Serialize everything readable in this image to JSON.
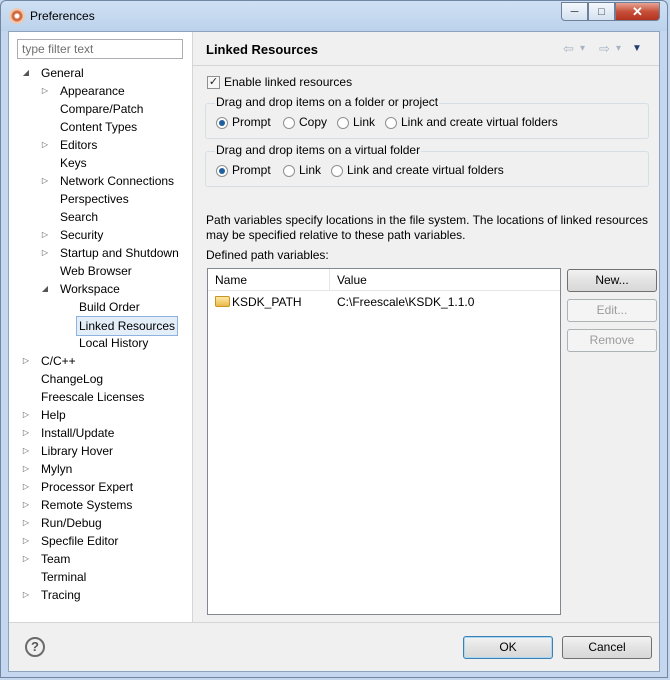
{
  "window": {
    "title": "Preferences"
  },
  "caption_buttons": {
    "minimize": "─",
    "maximize": "□",
    "close": "✕"
  },
  "filter": {
    "placeholder": "type filter text",
    "value": ""
  },
  "tree": [
    {
      "label": "General",
      "toggle": "◢"
    },
    {
      "label": "Appearance",
      "toggle": "▷"
    },
    {
      "label": "Compare/Patch",
      "toggle": ""
    },
    {
      "label": "Content Types",
      "toggle": ""
    },
    {
      "label": "Editors",
      "toggle": "▷"
    },
    {
      "label": "Keys",
      "toggle": ""
    },
    {
      "label": "Network Connections",
      "toggle": "▷"
    },
    {
      "label": "Perspectives",
      "toggle": ""
    },
    {
      "label": "Search",
      "toggle": ""
    },
    {
      "label": "Security",
      "toggle": "▷"
    },
    {
      "label": "Startup and Shutdown",
      "toggle": "▷"
    },
    {
      "label": "Web Browser",
      "toggle": ""
    },
    {
      "label": "Workspace",
      "toggle": "◢"
    },
    {
      "label": "Build Order",
      "toggle": ""
    },
    {
      "label": "Linked Resources",
      "toggle": ""
    },
    {
      "label": "Local History",
      "toggle": ""
    },
    {
      "label": "C/C++",
      "toggle": "▷"
    },
    {
      "label": "ChangeLog",
      "toggle": ""
    },
    {
      "label": "Freescale Licenses",
      "toggle": ""
    },
    {
      "label": "Help",
      "toggle": "▷"
    },
    {
      "label": "Install/Update",
      "toggle": "▷"
    },
    {
      "label": "Library Hover",
      "toggle": "▷"
    },
    {
      "label": "Mylyn",
      "toggle": "▷"
    },
    {
      "label": "Processor Expert",
      "toggle": "▷"
    },
    {
      "label": "Remote Systems",
      "toggle": "▷"
    },
    {
      "label": "Run/Debug",
      "toggle": "▷"
    },
    {
      "label": "Specfile Editor",
      "toggle": "▷"
    },
    {
      "label": "Team",
      "toggle": "▷"
    },
    {
      "label": "Terminal",
      "toggle": ""
    },
    {
      "label": "Tracing",
      "toggle": "▷"
    }
  ],
  "page": {
    "title": "Linked Resources",
    "nav": {
      "back": "⇦",
      "back_menu": "▾",
      "forward": "⇨",
      "forward_menu": "▾",
      "view_menu": "▼"
    },
    "enable_linked": {
      "label": "Enable linked resources",
      "checked": true,
      "mark": "✓"
    },
    "group1": {
      "title": "Drag and drop items on a folder or project",
      "options": [
        "Prompt",
        "Copy",
        "Link",
        "Link and create virtual folders"
      ],
      "selected": "Prompt"
    },
    "group2": {
      "title": "Drag and drop items on a virtual folder",
      "options": [
        "Prompt",
        "Link",
        "Link and create virtual folders"
      ],
      "selected": "Prompt"
    },
    "path_description": "Path variables specify locations in the file system. The locations of linked resources may be specified relative to these path variables.",
    "defined_label": "Defined path variables:",
    "table": {
      "columns": [
        "Name",
        "Value"
      ],
      "rows": [
        {
          "name": "KSDK_PATH",
          "value": "C:\\Freescale\\KSDK_1.1.0"
        }
      ]
    },
    "buttons": {
      "new": "New...",
      "edit": "Edit...",
      "remove": "Remove"
    }
  },
  "footer": {
    "help": "?",
    "ok": "OK",
    "cancel": "Cancel"
  }
}
